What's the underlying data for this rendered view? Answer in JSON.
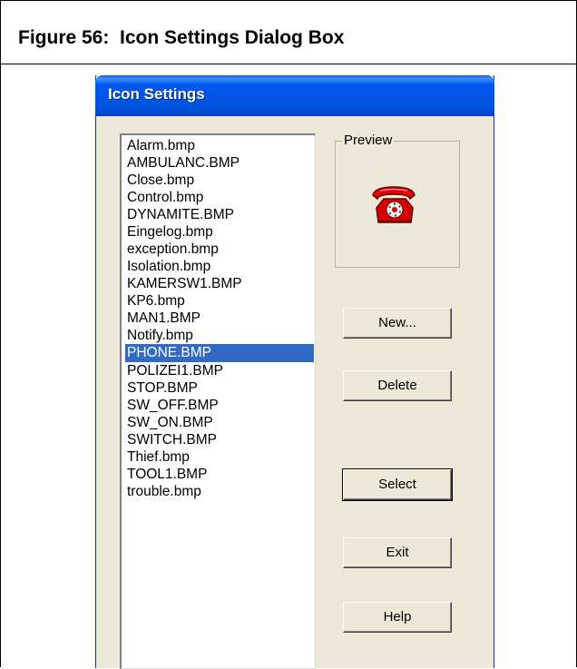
{
  "figure": {
    "caption": "Figure 56:  Icon Settings Dialog Box"
  },
  "dialog": {
    "title": "Icon Settings",
    "icon_list": {
      "items": [
        "Alarm.bmp",
        "AMBULANC.BMP",
        "Close.bmp",
        "Control.bmp",
        "DYNAMITE.BMP",
        "Eingelog.bmp",
        "exception.bmp",
        "Isolation.bmp",
        "KAMERSW1.BMP",
        "KP6.bmp",
        "MAN1.BMP",
        "Notify.bmp",
        "PHONE.BMP",
        "POLIZEI1.BMP",
        "STOP.BMP",
        "SW_OFF.BMP",
        "SW_ON.BMP",
        "SWITCH.BMP",
        "Thief.bmp",
        "TOOL1.BMP",
        "trouble.bmp"
      ],
      "selected_index": 12
    },
    "preview": {
      "label": "Preview",
      "icon": "red-telephone-icon"
    },
    "buttons": {
      "new": "New...",
      "delete": "Delete",
      "select": "Select",
      "exit": "Exit",
      "help": "Help"
    }
  },
  "colors": {
    "selection": "#316ac5",
    "titlebar": "#0054e3",
    "dialog_face": "#ece9d8"
  }
}
